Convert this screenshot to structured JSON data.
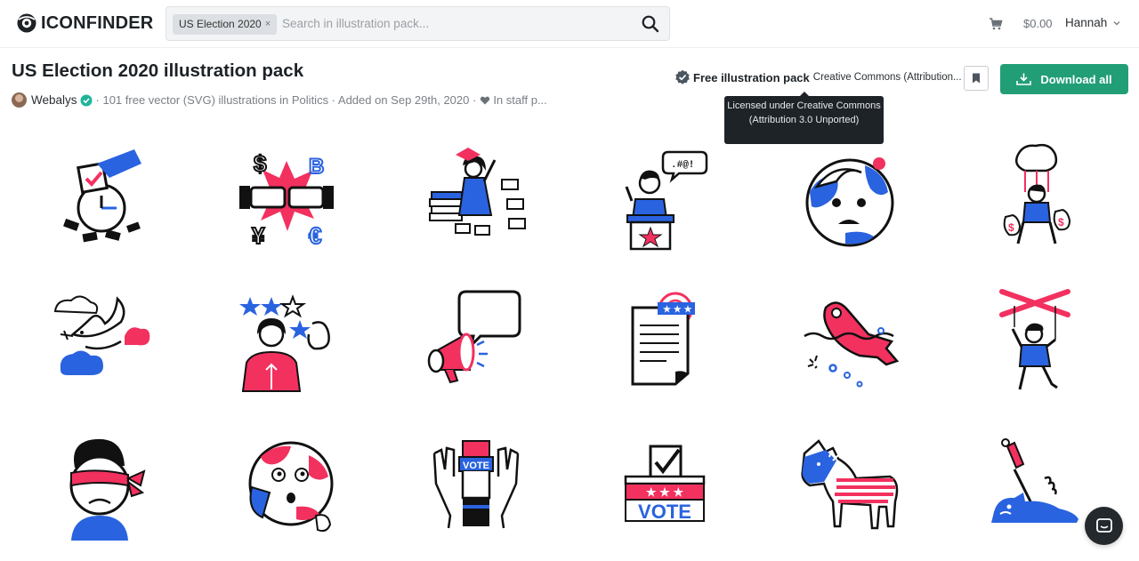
{
  "header": {
    "logo_text": "ICONFINDER",
    "search_tag": "US Election 2020",
    "search_tag_remove": "×",
    "search_placeholder": "Search in illustration pack...",
    "cart_total": "$0.00",
    "user_name": "Hannah"
  },
  "pack": {
    "title": "US Election 2020 illustration pack",
    "author": "Webalys",
    "summary": "· 101 free vector (SVG) illustrations in Politics · Added on Sep 29th, 2020 ·",
    "staff_pick": "In staff p...",
    "license_label": "Free illustration pack",
    "license_name": "Creative Commons (Attribution...",
    "tooltip": "Licensed under Creative Commons (Attribution 3.0 Unported)",
    "download_label": "Download all"
  },
  "colors": {
    "accent_green": "#229e77",
    "illustration_blue": "#2a63e0",
    "illustration_pink": "#f2315f",
    "ink": "#111111"
  },
  "illustrations": [
    {
      "name": "ballot-clock"
    },
    {
      "name": "currency-fist-bump"
    },
    {
      "name": "graduate-with-books"
    },
    {
      "name": "speaker-at-podium"
    },
    {
      "name": "worried-earth"
    },
    {
      "name": "puppet-with-money-bags"
    },
    {
      "name": "dove-with-clouds"
    },
    {
      "name": "woman-rating-stars"
    },
    {
      "name": "megaphone-speech-bubble"
    },
    {
      "name": "document-with-stamp"
    },
    {
      "name": "fish-on-water"
    },
    {
      "name": "man-on-strings"
    },
    {
      "name": "blindfolded-person"
    },
    {
      "name": "anxious-globe"
    },
    {
      "name": "raised-hands-vote"
    },
    {
      "name": "vote-ballot-box"
    },
    {
      "name": "democrat-donkey"
    },
    {
      "name": "sword-in-creature"
    }
  ],
  "vote_text": "VOTE",
  "icons": [
    "search-icon",
    "cart-icon",
    "chevron-down-icon",
    "verified-icon",
    "heart-icon",
    "license-badge-icon",
    "bookmark-icon",
    "download-icon",
    "chat-icon"
  ]
}
